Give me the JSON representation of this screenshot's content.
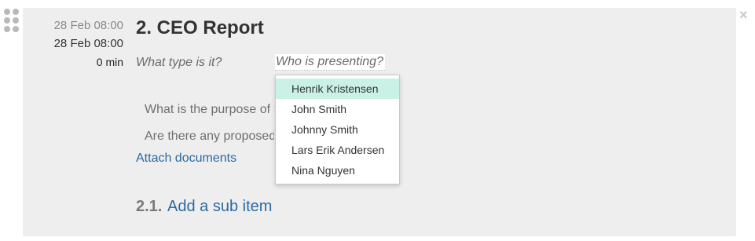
{
  "agenda_item": {
    "time_start": "28 Feb 08:00",
    "time_end": "28 Feb 08:00",
    "duration": "0 min",
    "title": "2. CEO Report",
    "type_placeholder": "What type is it?",
    "presenter_placeholder": "Who is presenting?",
    "questions": [
      "What is the purpose of t",
      "Are there any proposed"
    ],
    "attach_label": "Attach documents",
    "sub_item_number": "2.1.",
    "sub_item_label": "Add a sub item",
    "close_symbol": "×"
  },
  "presenter_dropdown": {
    "options": [
      "Henrik Kristensen",
      "John Smith",
      "Johnny Smith",
      "Lars Erik Andersen",
      "Nina Nguyen"
    ],
    "highlighted": "Henrik Kristensen"
  },
  "colors": {
    "card_background": "#eeeeee",
    "link": "#2c6aa5",
    "highlight": "#c9f1e6"
  },
  "icons": {
    "drag_handle": "drag-handle-icon",
    "close": "close-icon"
  }
}
